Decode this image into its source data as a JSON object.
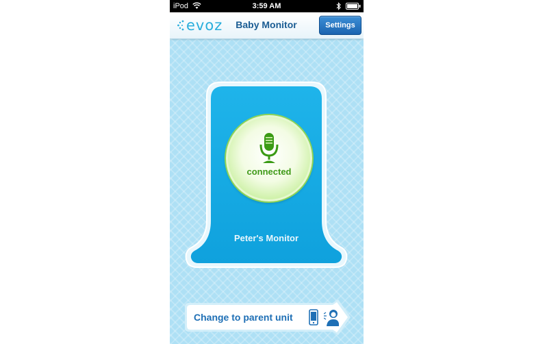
{
  "status_bar": {
    "carrier": "iPod",
    "time": "3:59 AM",
    "icons": [
      "wifi-icon",
      "bluetooth-icon",
      "battery-icon"
    ]
  },
  "nav_bar": {
    "logo_text": "evoz",
    "title": "Baby Monitor",
    "settings_label": "Settings"
  },
  "monitor": {
    "status": "connected",
    "name": "Peter's Monitor",
    "icon": "microphone-icon"
  },
  "bottom_action": {
    "label": "Change to parent unit",
    "icons": [
      "phone-icon",
      "parent-icon"
    ]
  },
  "colors": {
    "background": "#aee0f5",
    "card_blue": "#15abe6",
    "connected_green": "#3f9a17",
    "button_blue": "#1b64b0",
    "title_blue": "#1a5c93"
  }
}
